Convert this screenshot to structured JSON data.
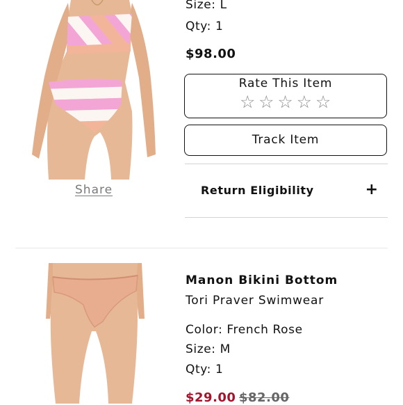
{
  "items": [
    {
      "image_icon": "swimsuit-photo-striped-bikini",
      "share_label": "Share",
      "size": "Size: L",
      "qty": "Qty: 1",
      "price": "$98.00",
      "rate_label": "Rate This Item",
      "rating": 0,
      "star_count": 5,
      "track_label": "Track Item",
      "return_label": "Return Eligibility",
      "expand_icon": "plus-icon"
    },
    {
      "image_icon": "swimsuit-photo-bikini-bottom",
      "name": "Manon Bikini Bottom",
      "brand": "Tori Praver Swimwear",
      "color": "Color: French Rose",
      "size": "Size: M",
      "qty": "Qty: 1",
      "sale_price": "$29.00",
      "original_price": "$82.00"
    }
  ],
  "colors": {
    "sale_price": "#a3152d",
    "original_price": "#666666",
    "stripe_pink": "#f3a6d6",
    "stripe_peach": "#f3b59a",
    "stripe_white": "#fbf6f2",
    "skin": "#e7b895",
    "bottom_nude": "#e8ad8e"
  }
}
